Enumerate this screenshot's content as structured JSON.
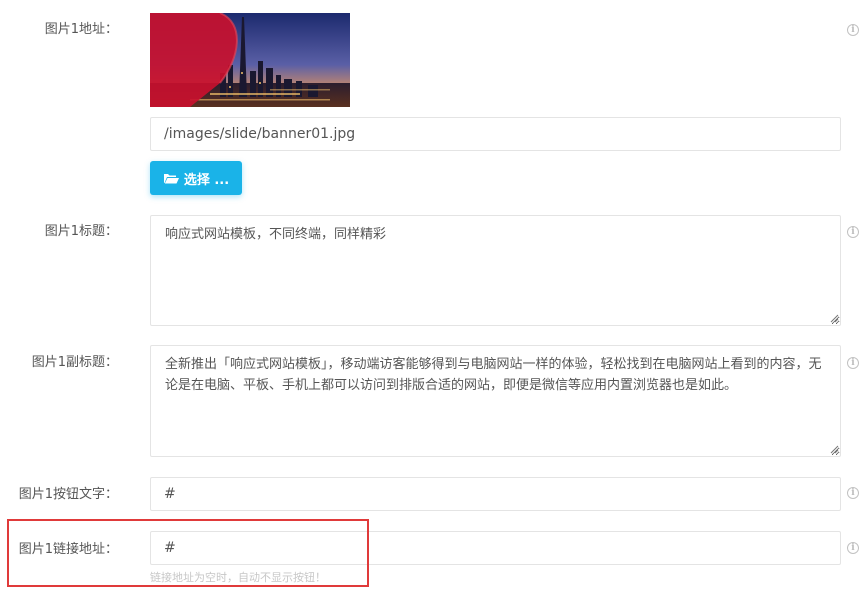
{
  "fields": {
    "image_url": {
      "label": "图片1地址：",
      "value": "/images/slide/banner01.jpg",
      "button_label": "选择 ..."
    },
    "title": {
      "label": "图片1标题：",
      "value": "响应式网站模板，不同终端，同样精彩"
    },
    "subtitle": {
      "label": "图片1副标题：",
      "value": "全新推出「响应式网站模板」，移动端访客能够得到与电脑网站一样的体验，轻松找到在电脑网站上看到的内容，无论是在电脑、平板、手机上都可以访问到排版合适的网站，即便是微信等应用内置浏览器也是如此。"
    },
    "button_text": {
      "label": "图片1按钮文字：",
      "value": "#"
    },
    "link_url": {
      "label": "图片1链接地址：",
      "value": "#",
      "hint": "链接地址为空时，自动不显示按钮！"
    }
  },
  "icons": {
    "info": "info-circle-icon",
    "folder": "folder-open-icon"
  },
  "colors": {
    "primary_button": "#1ab3e8",
    "highlight_border": "#e03a3a",
    "hint_text": "#c7c7c7"
  }
}
